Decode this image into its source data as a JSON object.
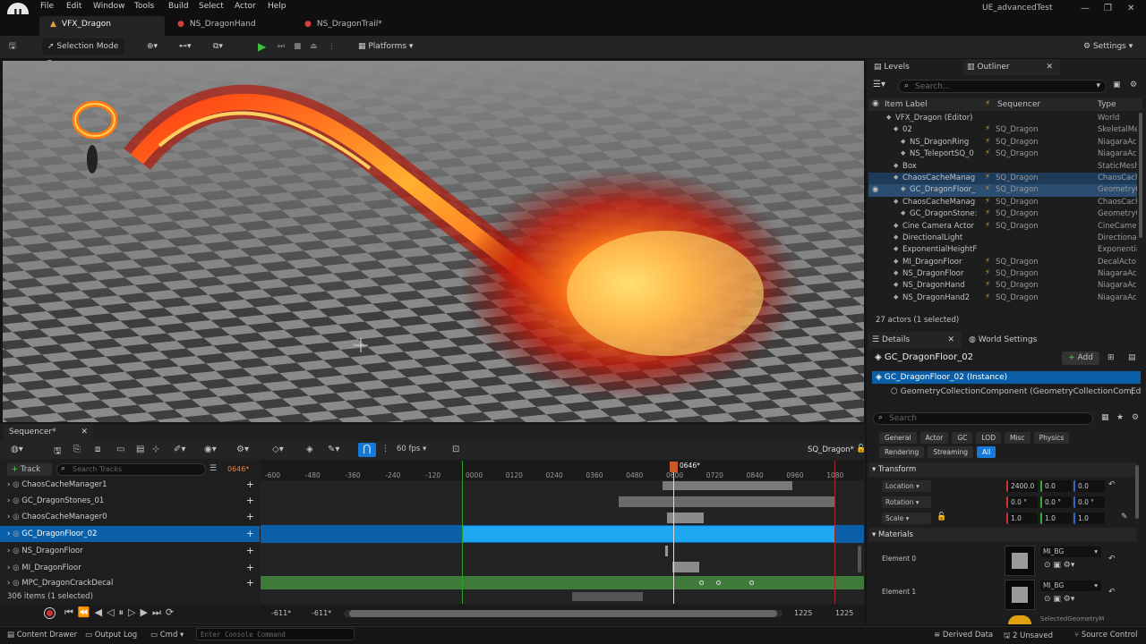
{
  "menu": [
    "File",
    "Edit",
    "Window",
    "Tools",
    "Build",
    "Select",
    "Actor",
    "Help"
  ],
  "project_name": "UE_advancedTest",
  "doc_tabs": [
    "VFX_Dragon",
    "NS_DragonHand",
    "NS_DragonTrail*"
  ],
  "toolbar": {
    "selection_mode": "Selection Mode",
    "platforms": "Platforms",
    "settings": "Settings"
  },
  "outliner": {
    "tabs": [
      "Levels",
      "Outliner"
    ],
    "search_placeholder": "Search...",
    "columns": [
      "Item Label",
      "Sequencer",
      "Type"
    ],
    "rows": [
      {
        "label": "VFX_Dragon (Editor)",
        "seq": "",
        "type": "World",
        "indent": 1
      },
      {
        "label": "02",
        "seq": "SQ_Dragon",
        "type": "SkeletalMe",
        "indent": 2
      },
      {
        "label": "NS_DragonRing",
        "seq": "SQ_Dragon",
        "type": "NiagaraAc",
        "indent": 3
      },
      {
        "label": "NS_TeleportSQ_0",
        "seq": "SQ_Dragon",
        "type": "NiagaraAc",
        "indent": 3
      },
      {
        "label": "Box",
        "seq": "",
        "type": "StaticMesh",
        "indent": 2
      },
      {
        "label": "ChaosCacheManag",
        "seq": "SQ_Dragon",
        "type": "ChaosCach",
        "indent": 2
      },
      {
        "label": "GC_DragonFloor_",
        "seq": "SQ_Dragon",
        "type": "GeometryC",
        "indent": 3
      },
      {
        "label": "ChaosCacheManag",
        "seq": "SQ_Dragon",
        "type": "ChaosCach",
        "indent": 2
      },
      {
        "label": "GC_DragonStone:",
        "seq": "SQ_Dragon",
        "type": "GeometryC",
        "indent": 3
      },
      {
        "label": "Cine Camera Actor",
        "seq": "SQ_Dragon",
        "type": "CineCamer",
        "indent": 2
      },
      {
        "label": "DirectionalLight",
        "seq": "",
        "type": "Directiona",
        "indent": 2
      },
      {
        "label": "ExponentialHeightF",
        "seq": "",
        "type": "Exponentia",
        "indent": 2
      },
      {
        "label": "MI_DragonFloor",
        "seq": "SQ_Dragon",
        "type": "DecalActo",
        "indent": 2
      },
      {
        "label": "NS_DragonFloor",
        "seq": "SQ_Dragon",
        "type": "NiagaraAc",
        "indent": 2
      },
      {
        "label": "NS_DragonHand",
        "seq": "SQ_Dragon",
        "type": "NiagaraAc",
        "indent": 2
      },
      {
        "label": "NS_DragonHand2",
        "seq": "SQ_Dragon",
        "type": "NiagaraAc",
        "indent": 2
      }
    ],
    "count": "27 actors (1 selected)"
  },
  "details": {
    "tabs": [
      "Details",
      "World Settings"
    ],
    "actor_name": "GC_DragonFloor_02",
    "add_label": "Add",
    "instance": "GC_DragonFloor_02 (Instance)",
    "component": "GeometryCollectionComponent (GeometryCollectionComponent0)",
    "component_edit": "Ed",
    "search_placeholder": "Search",
    "filters": [
      "General",
      "Actor",
      "GC",
      "LOD",
      "Misc",
      "Physics",
      "Rendering",
      "Streaming",
      "All"
    ],
    "transform_header": "Transform",
    "location": {
      "label": "Location",
      "x": "2400.0",
      "y": "0.0",
      "z": "0.0"
    },
    "rotation": {
      "label": "Rotation",
      "x": "0.0 °",
      "y": "0.0 °",
      "z": "0.0 °"
    },
    "scale": {
      "label": "Scale",
      "x": "1.0",
      "y": "1.0",
      "z": "1.0"
    },
    "materials_header": "Materials",
    "element0": {
      "label": "Element 0",
      "mat": "MI_BG"
    },
    "element1": {
      "label": "Element 1",
      "mat": "MI_BG"
    },
    "element2": {
      "mat": "SelectedGeometryM"
    }
  },
  "sequencer": {
    "tab": "Sequencer*",
    "fps": "60 fps",
    "seq_name": "SQ_Dragon*",
    "track_button": "Track",
    "search_placeholder": "Search Tracks",
    "current_frame": "0646*",
    "playhead_label": "0646*",
    "ruler": [
      "-600",
      "-480",
      "-360",
      "-240",
      "-120",
      "0000",
      "0120",
      "0240",
      "0360",
      "0480",
      "0600",
      "0720",
      "0840",
      "0960",
      "1080"
    ],
    "tracks": [
      "ChaosCacheManager1",
      "GC_DragonStones_01",
      "ChaosCacheManager0",
      "GC_DragonFloor_02",
      "NS_DragonFloor",
      "MI_DragonFloor",
      "MPC_DragonCrackDecal"
    ],
    "items_count": "306 items (1 selected)",
    "range_start": "-611*",
    "range_start2": "-611*",
    "range_end": "1225",
    "range_end2": "1225"
  },
  "status": {
    "content_drawer": "Content Drawer",
    "output_log": "Output Log",
    "cmd": "Cmd",
    "console_placeholder": "Enter Console Command",
    "derived": "Derived Data",
    "unsaved": "2 Unsaved",
    "source": "Source Control"
  }
}
